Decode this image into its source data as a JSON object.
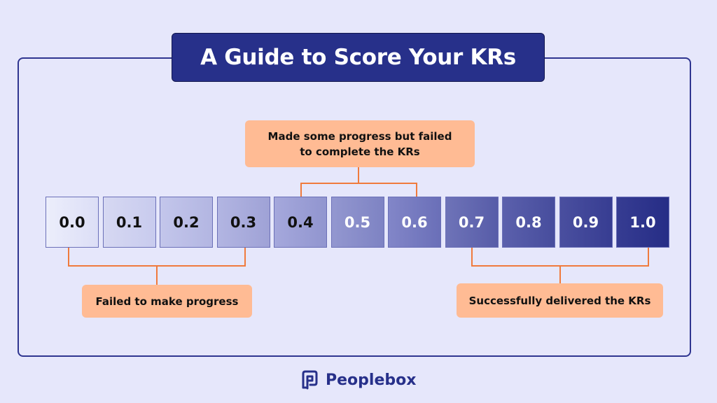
{
  "title": "A Guide to Score Your KRs",
  "scores": [
    {
      "label": "0.0",
      "bg_from": "#eceefb",
      "bg_to": "#dcdef6",
      "text_color": "#111111"
    },
    {
      "label": "0.1",
      "bg_from": "#d6d8f2",
      "bg_to": "#c8cbee",
      "text_color": "#111111"
    },
    {
      "label": "0.2",
      "bg_from": "#c3c6eb",
      "bg_to": "#b3b6e2",
      "text_color": "#111111"
    },
    {
      "label": "0.3",
      "bg_from": "#b2b5e2",
      "bg_to": "#9fa2d6",
      "text_color": "#111111"
    },
    {
      "label": "0.4",
      "bg_from": "#a5a8dc",
      "bg_to": "#9195cf",
      "text_color": "#111111"
    },
    {
      "label": "0.5",
      "bg_from": "#9397d0",
      "bg_to": "#7e83c3",
      "text_color": "#ffffff"
    },
    {
      "label": "0.6",
      "bg_from": "#8286c8",
      "bg_to": "#6a6fb8",
      "text_color": "#ffffff"
    },
    {
      "label": "0.7",
      "bg_from": "#6e73b8",
      "bg_to": "#575ca8",
      "text_color": "#ffffff"
    },
    {
      "label": "0.8",
      "bg_from": "#5b60ac",
      "bg_to": "#474d9d",
      "text_color": "#ffffff"
    },
    {
      "label": "0.9",
      "bg_from": "#4a4f9f",
      "bg_to": "#373d92",
      "text_color": "#ffffff"
    },
    {
      "label": "1.0",
      "bg_from": "#363c92",
      "bg_to": "#262d86",
      "text_color": "#ffffff"
    }
  ],
  "callouts": {
    "middle": {
      "line1": "Made some progress but failed",
      "line2": "to complete the KRs",
      "range": "0.4 – 0.6"
    },
    "low": {
      "text": "Failed to make progress",
      "range": "0.0 – 0.3"
    },
    "high": {
      "text": "Successfully delivered the KRs",
      "range": "0.7 – 1.0"
    }
  },
  "colors": {
    "accent": "#27308a",
    "callout_bg": "#ffbb94",
    "bracket": "#f07a3c",
    "background": "#e6e7fb"
  },
  "brand": {
    "name": "Peoplebox",
    "icon": "peoplebox-logo-icon"
  }
}
